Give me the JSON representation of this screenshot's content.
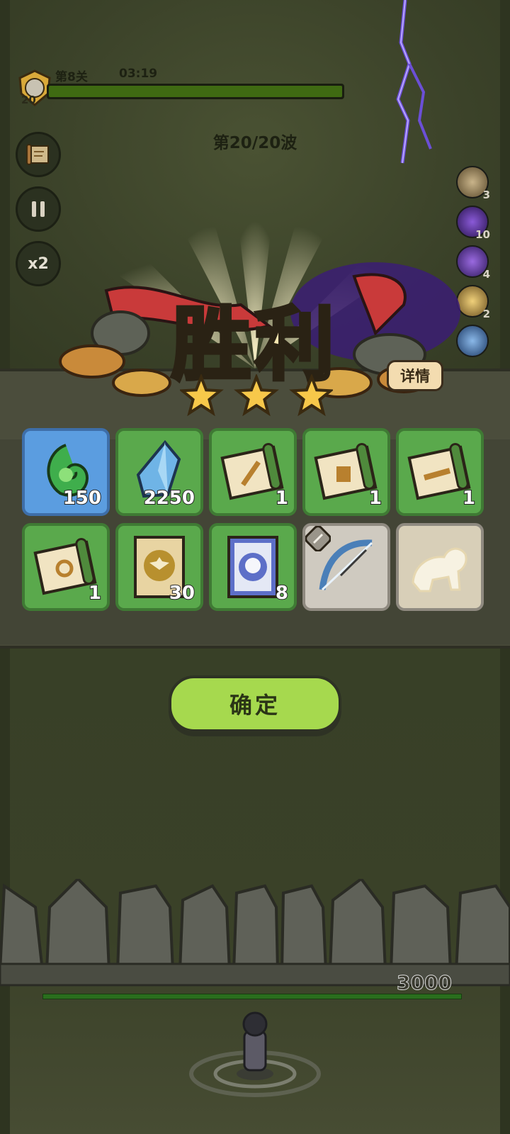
{
  "hud": {
    "level_number": "20",
    "stage": "第8关",
    "timer": "03:19",
    "stage_progress": 1.0,
    "wave": "第20/20波",
    "speed": "x2"
  },
  "buffs": [
    {
      "icon": "stone-hand-icon",
      "count": "3"
    },
    {
      "icon": "purple-vortex-icon",
      "count": "10"
    },
    {
      "icon": "purple-slash-icon",
      "count": "4"
    },
    {
      "icon": "golden-wings-icon",
      "count": "2"
    },
    {
      "icon": "blue-spirit-icon",
      "count": ""
    }
  ],
  "victory": {
    "title": "胜利",
    "details_label": "详情",
    "stars": 3
  },
  "rewards": [
    {
      "icon": "green-spiral-gem-icon",
      "count": "150",
      "style": "blue"
    },
    {
      "icon": "blue-crystal-icon",
      "count": "2250",
      "style": "green"
    },
    {
      "icon": "sword-scroll-icon",
      "count": "1",
      "style": "green"
    },
    {
      "icon": "armor-scroll-icon",
      "count": "1",
      "style": "green"
    },
    {
      "icon": "belt-scroll-icon",
      "count": "1",
      "style": "green"
    },
    {
      "icon": "ring-scroll-icon",
      "count": "1",
      "style": "green"
    },
    {
      "icon": "eagle-scroll-icon",
      "count": "30",
      "style": "green"
    },
    {
      "icon": "skull-scroll-icon",
      "count": "8",
      "style": "green"
    },
    {
      "icon": "ice-bow-icon",
      "count": "",
      "style": "grey"
    },
    {
      "icon": "white-tiger-icon",
      "count": "",
      "style": "grey"
    }
  ],
  "confirm_label": "确定",
  "wall_hp": "3000",
  "colors": {
    "confirm": "#a6d94e",
    "tile_green": "#5aa94c",
    "tile_blue": "#5b9de0",
    "progress": "#3f6a12"
  }
}
